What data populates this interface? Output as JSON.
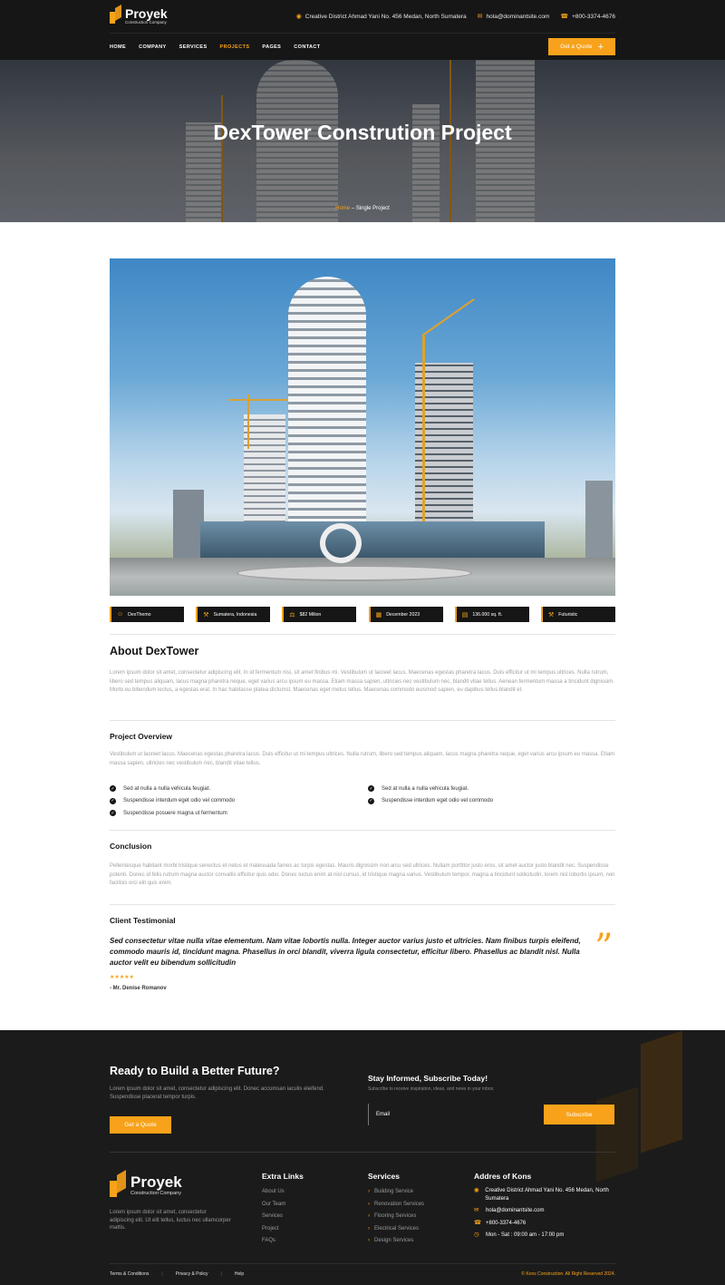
{
  "header": {
    "logo_name": "Proyek",
    "logo_sub": "Construction Company",
    "address": "Creative District Ahmad Yani No. 456 Medan, North Sumatera",
    "email": "hola@dominantsite.com",
    "phone": "+800-3374-4676",
    "nav": [
      "HOME",
      "COMPANY",
      "SERVICES",
      "PROJECTS",
      "PAGES",
      "CONTACT"
    ],
    "active_nav": "PROJECTS",
    "quote_btn": "Get a Quote"
  },
  "hero": {
    "title": "DexTower Constrution Project",
    "crumb_home": "Home",
    "crumb_sep": " – ",
    "crumb_current": "Single Project"
  },
  "chips": [
    {
      "icon": "user-icon",
      "label": "DexThemo"
    },
    {
      "icon": "pin-icon",
      "label": "Sumatera, Indonesia"
    },
    {
      "icon": "money-icon",
      "label": "$82 Milion"
    },
    {
      "icon": "calendar-icon",
      "label": "December 2023"
    },
    {
      "icon": "building-icon",
      "label": "136.000 sq. ft."
    },
    {
      "icon": "tool-icon",
      "label": "Futuristic"
    }
  ],
  "about": {
    "title": "About DexTower",
    "text": "Lorem ipsum dolor sit amet, consectetur adipiscing elit. In id fermentum nisi, sit amet finibus mi. Vestibulum ut laoreet lacus. Maecenas egestas pharetra lacus. Duis efficitur ut mi tempus ultrices. Nulla rutrum, libero sed tempus aliquam, lacus magna pharetra neque, eget varius arcu ipsum eu massa. Etiam massa sapien, ultricies nec vestibulum nec, blandit vitae tellus. Aenean fermentum massa a tincidunt dignissim. Morbi eu bibendum lectus, a egestas erat. In hac habitasse platea dictumst. Maecenas eget metus tellus. Maecenas commodo euismod sapien, eu dapibus tellus blandit et."
  },
  "overview": {
    "title": "Project Overview",
    "text": "Vestibulum ut laoreet lacus. Maecenas egestas pharetra lacus. Duis efficitur ut mi tempus ultrices. Nulla rutrum, libero sed tempus aliquam, lacus magna pharetra neque, eget varius arcu ipsum eu massa. Etiam massa sapien, ultricies nec vestibulum nec, blandit vitae tellus.",
    "checks": [
      "Sed at nulla a nulla vehicula feugiat.",
      "Sed at nulla a nulla vehicula feugiat.",
      "Suspendisse interdum eget odio vel commodo",
      "Suspendisse interdum eget odio vel commodo",
      "Suspendisse posuere magna ut fermentum"
    ]
  },
  "conclusion": {
    "title": "Conclusion",
    "text": "Pellentesque habitant morbi tristique senectus et netus et malesuada fames ac turpis egestas. Mauris dignissim non arcu sed ultrices. Nullam porttitor justo eros, sit amet auctor justo blandit nec. Suspendisse potenti. Donec id felis rutrum magna auctor convallis efficitur quis odio. Donec luctus enim at nisl cursus, id tristique magna varius. Vestibulum tempor, magna a tincidunt sollicitudin, lorem nisl lobortis ipsum, non facilisis orci elit quis enim."
  },
  "testimonial": {
    "title": "Client Testimonial",
    "quote": "Sed consectetur vitae nulla vitae elementum. Nam vitae lobortis nulla. Integer auctor varius justo et ultricies. Nam finibus turpis eleifend, commodo mauris id, tincidunt magna. Phasellus in orci blandit, viverra ligula consectetur, efficitur libero. Phasellus ac blandit nisl. Nulla auctor velit eu bibendum sollicitudin",
    "stars": "★★★★★",
    "author": "- Mr. Denise Romanov"
  },
  "footer": {
    "cta_title": "Ready to Build a Better Future?",
    "cta_text": "Lorem ipsum dolor sit amet, consectetur adipiscing elit. Donec accumsan iaculis eleifend. Suspendisse placerat tempor turpis.",
    "cta_btn": "Get a Quote",
    "sub_title": "Stay Informed, Subscribe Today!",
    "sub_text": "Subscribe to receive inspiration, ideas, and news in your inbox.",
    "email_placeholder": "Email",
    "sub_btn": "Subscribe",
    "logo_name": "Proyek",
    "logo_sub": "Construction Company",
    "about": "Lorem ipsum dolor sit amet, consectetur adipiscing elit. Ut elit tellus, luctus nec ullamcorper mattis.",
    "extra_title": "Extra Links",
    "extra_links": [
      "About Us",
      "Our Team",
      "Services",
      "Project",
      "FAQs"
    ],
    "services_title": "Services",
    "services": [
      "Building Service",
      "Renovation Services",
      "Flooring Services",
      "Electrical Services",
      "Design Services"
    ],
    "address_title": "Addres of Kons",
    "address": "Creative District Ahmad Yani No. 456 Medan, North Sumatera",
    "email": "hola@dominantsite.com",
    "phone": "+800-3374-4676",
    "hours": "Mon - Sat : 09:00 am - 17:00 pm",
    "legal": [
      "Terms & Conditions",
      "Privacy & Policy",
      "Help"
    ],
    "copyright": "© Kons Construction. All Right Reserved 2024."
  },
  "colors": {
    "accent": "#f7a21a",
    "dark": "#161616",
    "footer": "#1c1b1b"
  }
}
